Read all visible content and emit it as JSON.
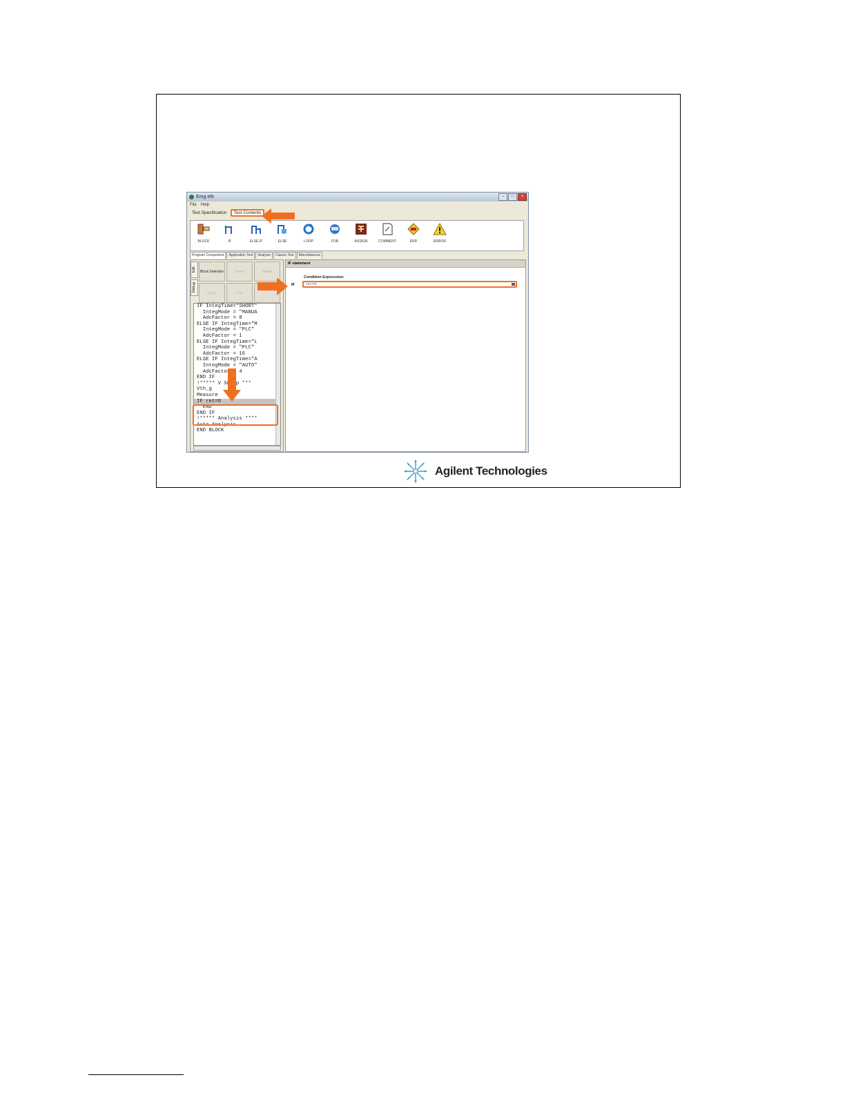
{
  "window": {
    "title": "Emg eth",
    "menu": [
      "File",
      "Help"
    ],
    "tabs": [
      {
        "label": "Test Specification"
      },
      {
        "label": "Test Contents"
      }
    ]
  },
  "toolbar": {
    "items": [
      {
        "label": "BLOCK",
        "icon": "block-icon"
      },
      {
        "label": "IF",
        "icon": "if-icon"
      },
      {
        "label": "ELSE IF",
        "icon": "else-if-icon"
      },
      {
        "label": "ELSE",
        "icon": "else-icon"
      },
      {
        "label": "LOOP",
        "icon": "loop-icon"
      },
      {
        "label": "FOR",
        "icon": "for-icon"
      },
      {
        "label": "ASSIGN",
        "icon": "assign-icon"
      },
      {
        "label": "COMMENT",
        "icon": "comment-icon"
      },
      {
        "label": "END",
        "icon": "end-icon"
      },
      {
        "label": "ERROR",
        "icon": "error-icon"
      }
    ]
  },
  "component_tabs": [
    "Program Component",
    "Application Test",
    "Analysis",
    "Classic Test",
    "Miscellaneous"
  ],
  "side_tabs": [
    "Edit",
    "Debug"
  ],
  "left_buttons": [
    "Block Selection",
    "Insert",
    "Delete",
    "Copy",
    "Cut",
    ""
  ],
  "code_lines": [
    "IF IntegTime=\"SHORT\"",
    "  IntegMode = \"MANUA",
    "  AdcFactor = 8",
    "ELSE IF IntegTime=\"M",
    "  IntegMode = \"PLC\"",
    "  AdcFactor = 1",
    "ELSE IF IntegTime=\"L",
    "  IntegMode = \"PLC\"",
    "  AdcFactor = 16",
    "ELSE IF IntegTime=\"A",
    "  IntegMode = \"AUTO\"",
    "  AdcFactor = 4",
    "END IF",
    "!***** V Sweep ***",
    "Vth_g",
    "Measure",
    "IF ret=0",
    "  END",
    "END IF",
    "!***** Analysis ****",
    "Auto Analysis",
    "END BLOCK"
  ],
  "selected_line_index": 16,
  "statement": {
    "header": "IF statement",
    "condition_label": "Condition Expression:",
    "if_label": "IF",
    "condition_value": "ret=0"
  },
  "logo": {
    "text": "Agilent Technologies"
  },
  "colors": {
    "highlight": "#f07022",
    "window_bg": "#ece9d8"
  }
}
